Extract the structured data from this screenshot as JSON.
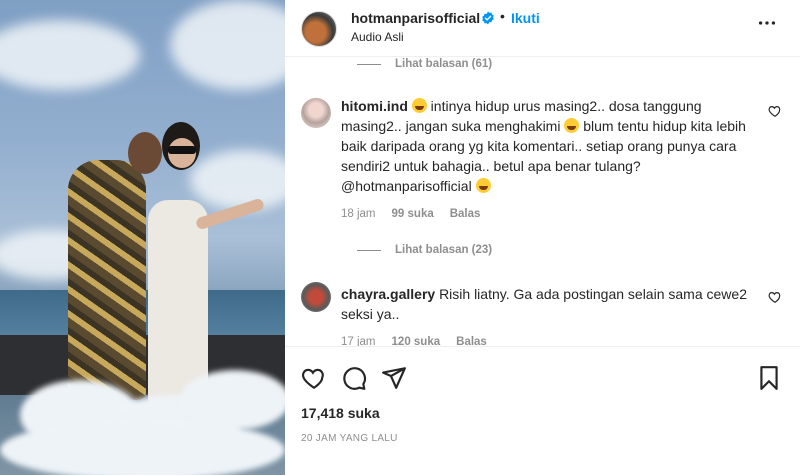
{
  "post": {
    "username": "hotmanparisofficial",
    "follow_label": "Ikuti",
    "audio_label": "Audio Asli",
    "dot": "•"
  },
  "comments": {
    "top_reply_label": "Lihat balasan (61)",
    "items": [
      {
        "username": "hitomi.ind",
        "text_1": "intinya hidup urus masing2.. dosa tanggung masing2.. jangan suka menghakimi",
        "text_2": "blum tentu hidup kita lebih baik daripada orang yg kita komentari.. setiap orang punya cara sendiri2 untuk bahagia.. betul apa benar tulang? @hotmanparisofficial",
        "time": "18 jam",
        "likes": "99 suka",
        "reply": "Balas",
        "replies_label": "Lihat balasan (23)"
      },
      {
        "username": "chayra.gallery",
        "text_1": "Risih liatny. Ga ada postingan selain sama cewe2 seksi ya..",
        "time": "17 jam",
        "likes": "120 suka",
        "reply": "Balas"
      }
    ]
  },
  "actions": {
    "likes_count": "17,418 suka",
    "timestamp": "20 JAM YANG LALU"
  },
  "colors": {
    "accent": "#0095f6",
    "verified": "#0095f6",
    "muted": "#8e8e8e",
    "text": "#262626"
  },
  "icons": [
    "verified-icon",
    "more-options-icon",
    "heart-icon",
    "comment-icon",
    "share-icon",
    "bookmark-icon",
    "grin-emoji-icon"
  ]
}
